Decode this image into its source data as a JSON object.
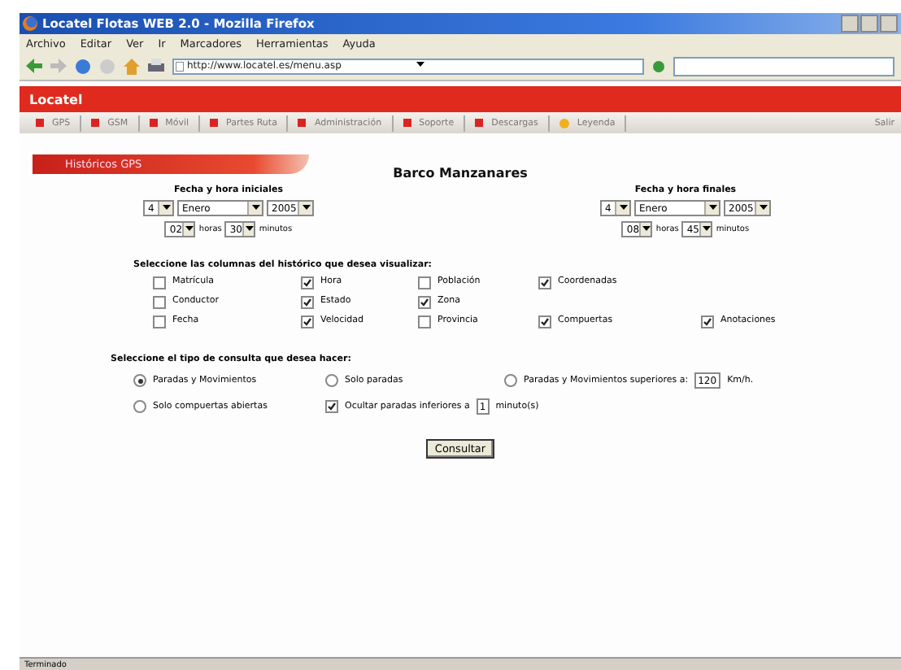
{
  "window": {
    "title": "Locatel Flotas WEB 2.0 - Mozilla Firefox"
  },
  "menu": [
    "Archivo",
    "Editar",
    "Ver",
    "Ir",
    "Marcadores",
    "Herramientas",
    "Ayuda"
  ],
  "address": {
    "value": "http://www.locatel.es/menu.asp"
  },
  "brand": "Locatel",
  "nav": [
    {
      "label": "GPS",
      "kind": "square"
    },
    {
      "label": "GSM",
      "kind": "square"
    },
    {
      "label": "Móvil",
      "kind": "square"
    },
    {
      "label": "Partes Ruta",
      "kind": "square"
    },
    {
      "label": "Administración",
      "kind": "square"
    },
    {
      "label": "Soporte",
      "kind": "square"
    },
    {
      "label": "Descargas",
      "kind": "square"
    },
    {
      "label": "Leyenda",
      "kind": "circle"
    }
  ],
  "logout": "Salir",
  "section_banner": "Históricos GPS",
  "page_title": "Barco Manzanares",
  "start": {
    "label": "Fecha y hora iniciales",
    "day": "4",
    "month": "Enero",
    "year": "2005",
    "hour": "02",
    "hour_unit": "horas",
    "minute": "30",
    "minute_unit": "minutos"
  },
  "end": {
    "label": "Fecha y hora finales",
    "day": "4",
    "month": "Enero",
    "year": "2005",
    "hour": "08",
    "hour_unit": "horas",
    "minute": "45",
    "minute_unit": "minutos"
  },
  "columns_heading": "Seleccione las columnas del histórico que desea visualizar:",
  "columns": [
    [
      {
        "label": "Matrícula",
        "checked": false
      },
      {
        "label": "Hora",
        "checked": true
      },
      {
        "label": "Población",
        "checked": false
      },
      {
        "label": "Coordenadas",
        "checked": true
      }
    ],
    [
      {
        "label": "Conductor",
        "checked": false
      },
      {
        "label": "Estado",
        "checked": true
      },
      {
        "label": "Zona",
        "checked": true
      }
    ],
    [
      {
        "label": "Fecha",
        "checked": false
      },
      {
        "label": "Velocidad",
        "checked": true
      },
      {
        "label": "Provincia",
        "checked": false
      },
      {
        "label": "Compuertas",
        "checked": true
      },
      {
        "label": "Anotaciones",
        "checked": true
      }
    ]
  ],
  "query_heading": "Seleccione el tipo de consulta que desea hacer:",
  "query_options": [
    {
      "kind": "radio",
      "label": "Paradas y Movimientos",
      "selected": true
    },
    {
      "kind": "radio",
      "label": "Solo paradas",
      "selected": false
    },
    {
      "kind": "radio",
      "label": "Paradas y Movimientos superiores a:",
      "selected": false,
      "value": "120",
      "suffix": "Km/h."
    },
    {
      "kind": "radio",
      "label": "Solo compuertas abiertas",
      "selected": false
    },
    {
      "kind": "checkbox",
      "label": "Ocultar paradas inferiores a",
      "checked": true,
      "value": "1",
      "suffix": "minuto(s)"
    }
  ],
  "submit": "Consultar",
  "status_bar": "Terminado"
}
